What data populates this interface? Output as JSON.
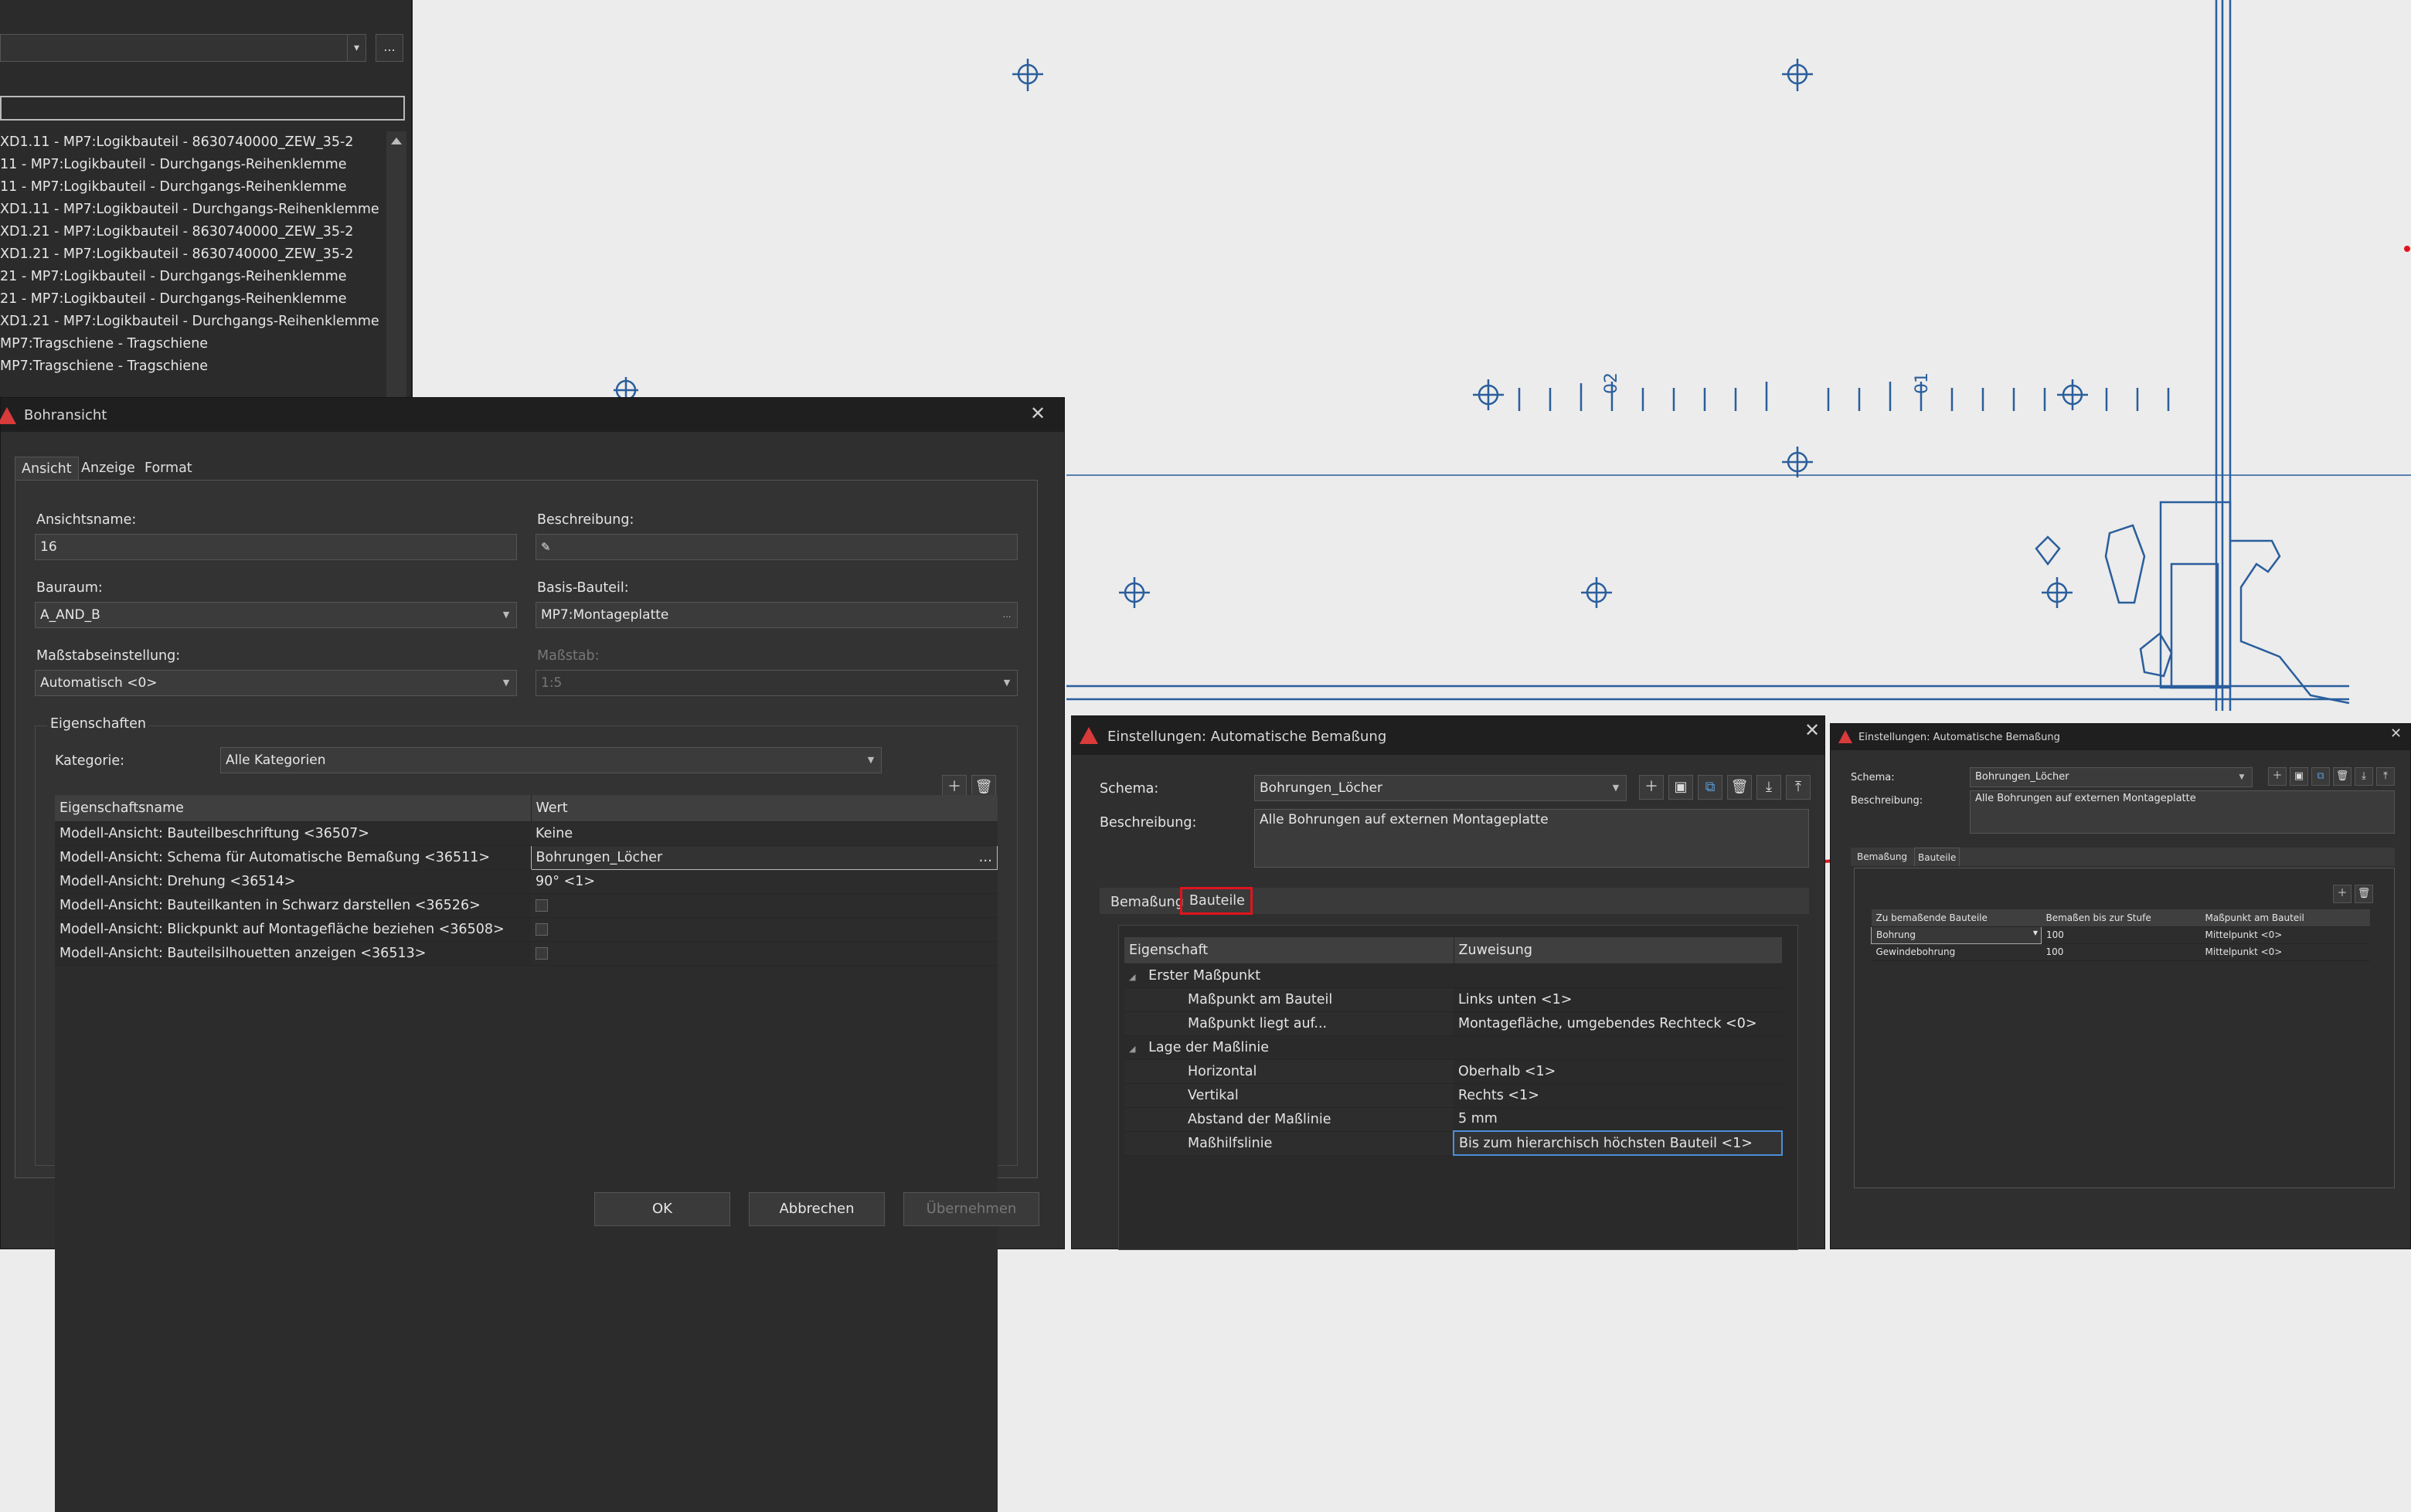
{
  "left_panel": {
    "combo_more": "...",
    "list_items": [
      "XD1.11 - MP7:Logikbauteil - 8630740000_ZEW_35-2",
      "11 - MP7:Logikbauteil - Durchgangs-Reihenklemme",
      "11 - MP7:Logikbauteil - Durchgangs-Reihenklemme",
      "XD1.11 - MP7:Logikbauteil - Durchgangs-Reihenklemme",
      "XD1.21 - MP7:Logikbauteil - 8630740000_ZEW_35-2",
      "XD1.21 - MP7:Logikbauteil - 8630740000_ZEW_35-2",
      "21 - MP7:Logikbauteil - Durchgangs-Reihenklemme",
      "21 - MP7:Logikbauteil - Durchgangs-Reihenklemme",
      "XD1.21 - MP7:Logikbauteil - Durchgangs-Reihenklemme",
      "MP7:Tragschiene - Tragschiene",
      "MP7:Tragschiene - Tragschiene"
    ]
  },
  "drawing": {
    "labels": [
      "02",
      "01"
    ]
  },
  "bohr": {
    "title": "Bohransicht",
    "tabs": [
      "Ansicht",
      "Anzeige",
      "Format"
    ],
    "ansichtsname_label": "Ansichtsname:",
    "ansichtsname_value": "16",
    "beschreibung_label": "Beschreibung:",
    "bauraum_label": "Bauraum:",
    "bauraum_value": "A_AND_B",
    "basis_label": "Basis-Bauteil:",
    "basis_value": "MP7:Montageplatte",
    "massstabeinst_label": "Maßstabseinstellung:",
    "massstabeinst_value": "Automatisch <0>",
    "massstab_label": "Maßstab:",
    "massstab_value": "1:5",
    "group_label": "Eigenschaften",
    "kategorie_label": "Kategorie:",
    "kategorie_value": "Alle Kategorien",
    "col_name": "Eigenschaftsname",
    "col_wert": "Wert",
    "rows": [
      {
        "name": "Modell-Ansicht: Bauteilbeschriftung <36507>",
        "wert": "Keine"
      },
      {
        "name": "Modell-Ansicht: Schema für Automatische Bemaßung <36511>",
        "wert": "Bohrungen_Löcher"
      },
      {
        "name": "Modell-Ansicht: Drehung <36514>",
        "wert": "90° <1>"
      },
      {
        "name": "Modell-Ansicht: Bauteilkanten in Schwarz darstellen <36526>",
        "wert": ""
      },
      {
        "name": "Modell-Ansicht: Blickpunkt auf Montagefläche beziehen <36508>",
        "wert": ""
      },
      {
        "name": "Modell-Ansicht: Bauteilsilhouetten anzeigen <36513>",
        "wert": ""
      }
    ],
    "ok": "OK",
    "abbrechen": "Abbrechen",
    "uebernehmen": "Übernehmen"
  },
  "auto": {
    "title": "Einstellungen: Automatische Bemaßung",
    "schema_label": "Schema:",
    "schema_value": "Bohrungen_Löcher",
    "beschreibung_label": "Beschreibung:",
    "beschreibung_value": "Alle Bohrungen auf externen Montageplatte",
    "tabs": [
      "Bemaßung",
      "Bauteile"
    ],
    "col_eig": "Eigenschaft",
    "col_zuw": "Zuweisung",
    "rows": [
      {
        "name": "Erster Maßpunkt",
        "value": "",
        "group": true
      },
      {
        "name": "Maßpunkt am Bauteil",
        "value": "Links unten <1>"
      },
      {
        "name": "Maßpunkt liegt auf...",
        "value": "Montagefläche, umgebendes Rechteck <0>"
      },
      {
        "name": "Lage der Maßlinie",
        "value": "",
        "group": true
      },
      {
        "name": "Horizontal",
        "value": "Oberhalb <1>"
      },
      {
        "name": "Vertikal",
        "value": "Rechts <1>"
      },
      {
        "name": "Abstand der Maßlinie",
        "value": "5 mm"
      },
      {
        "name": "Maßhilfslinie",
        "value": "Bis zum hierarchisch höchsten Bauteil <1>"
      }
    ]
  },
  "small": {
    "title": "Einstellungen: Automatische Bemaßung",
    "schema_label": "Schema:",
    "schema_value": "Bohrungen_Löcher",
    "beschreibung_label": "Beschreibung:",
    "beschreibung_value": "Alle Bohrungen auf externen Montageplatte",
    "tabs": [
      "Bemaßung",
      "Bauteile"
    ],
    "cols": [
      "Zu bemaßende Bauteile",
      "Bemaßen bis zur Stufe",
      "Maßpunkt am Bauteil"
    ],
    "rows": [
      {
        "a": "Bohrung",
        "b": "100",
        "c": "Mittelpunkt <0>"
      },
      {
        "a": "Gewindebohrung",
        "b": "100",
        "c": "Mittelpunkt <0>"
      }
    ]
  },
  "colors": {
    "accent_red": "#e0141e",
    "drawing_blue": "#2a5e9c"
  }
}
